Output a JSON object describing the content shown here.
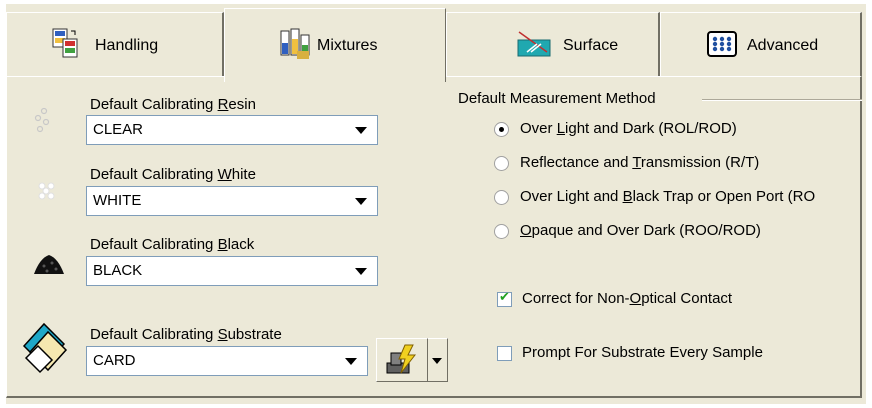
{
  "tabs": [
    {
      "label": "Handling",
      "icon": "handling-icon"
    },
    {
      "label": "Mixtures",
      "icon": "mixtures-icon"
    },
    {
      "label": "Surface",
      "icon": "surface-icon"
    },
    {
      "label": "Advanced",
      "icon": "advanced-icon"
    }
  ],
  "active_tab": "Mixtures",
  "resin": {
    "label_pre": "Default Calibrating ",
    "label_key": "R",
    "label_post": "esin",
    "value": "CLEAR"
  },
  "white": {
    "label_pre": "Default Calibrating ",
    "label_key": "W",
    "label_post": "hite",
    "value": "WHITE"
  },
  "black": {
    "label_pre": "Default Calibrating ",
    "label_key": "B",
    "label_post": "lack",
    "value": "BLACK"
  },
  "substrate": {
    "label_pre": "Default Calibrating ",
    "label_key": "S",
    "label_post": "ubstrate",
    "value": "CARD"
  },
  "measurement": {
    "title": "Default Measurement Method",
    "options": [
      {
        "pre": "Over ",
        "key": "L",
        "post": "ight and Dark (ROL/ROD)",
        "selected": true
      },
      {
        "pre": "Reflectance and ",
        "key": "T",
        "post": "ransmission (R/T)",
        "selected": false
      },
      {
        "pre": "Over Light and ",
        "key": "B",
        "post": "lack Trap or Open Port (RO",
        "selected": false
      },
      {
        "pre": "",
        "key": "O",
        "post": "paque and Over Dark (ROO/ROD)",
        "selected": false
      }
    ]
  },
  "correct_contact": {
    "pre": "Correct for Non-",
    "key": "O",
    "post": "ptical Contact",
    "checked": true
  },
  "prompt_substrate": {
    "label": "Prompt For Substrate Every Sample",
    "checked": false
  },
  "colors": {
    "background": "#ece9d8",
    "field_border": "#7f9db9"
  }
}
